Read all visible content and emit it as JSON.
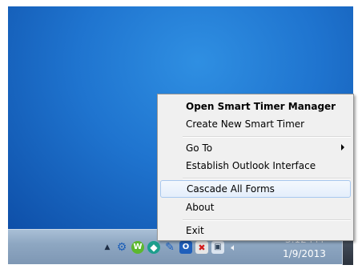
{
  "context_menu": {
    "items": [
      {
        "label": "Open Smart Timer Manager"
      },
      {
        "label": "Create New Smart Timer"
      },
      {
        "label": "Go To"
      },
      {
        "label": "Establish Outlook Interface"
      },
      {
        "label": "Cascade All Forms"
      },
      {
        "label": "About"
      },
      {
        "label": "Exit"
      }
    ]
  },
  "taskbar": {
    "tray_icons": [
      "show-hidden-icons-arrow-icon",
      "gear-app-icon",
      "green-w-app-icon",
      "green-teal-app-icon",
      "blue-tool-app-icon",
      "outlook-app-icon",
      "red-x-flag-icon",
      "network-icon",
      "speaker-icon"
    ],
    "clock": {
      "time": "3:12 PM",
      "date": "1/9/2013"
    }
  },
  "colors": {
    "desktop": "#1f74cf",
    "taskbar": "#8ea7c2",
    "menu_bg": "#f0f0f0",
    "menu_hover_border": "#a8c8ee"
  }
}
